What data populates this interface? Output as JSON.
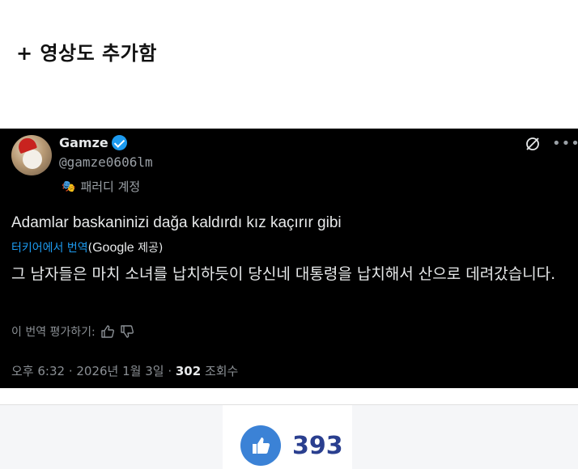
{
  "post": {
    "caption": "+ 영상도 추가함"
  },
  "tweet": {
    "author_name": "Gamze",
    "handle": "@gamze0606lm",
    "account_label": "패러디 계정",
    "original_text": "Adamlar baskaninizi dağa kaldırdı kız kaçırır gibi",
    "translated_from_link": "터키어에서 번역",
    "translated_by_prefix": "(",
    "translated_by_brand": "Google",
    "translated_by_suffix": " 제공)",
    "translation_text": "그 남자들은 마치 소녀를 납치하듯이 당신네 대통령을 납치해서 산으로 데려갔습니다.",
    "rate_label": "이 번역 평가하기:",
    "timestamp": "오후 6:32 · 2026년 1월 3일 · ",
    "views_count": "302",
    "views_label": " 조회수",
    "icons": [
      "verified-badge-icon",
      "grok-icon",
      "more-icon",
      "mask-icon",
      "thumbs-up-icon",
      "thumbs-down-icon"
    ]
  },
  "reaction": {
    "like_count": "393",
    "like_color": "#3b82d6"
  },
  "colors": {
    "tweet_bg": "#000000",
    "accent": "#1d9bf0",
    "count_color": "#2a3f8f"
  }
}
